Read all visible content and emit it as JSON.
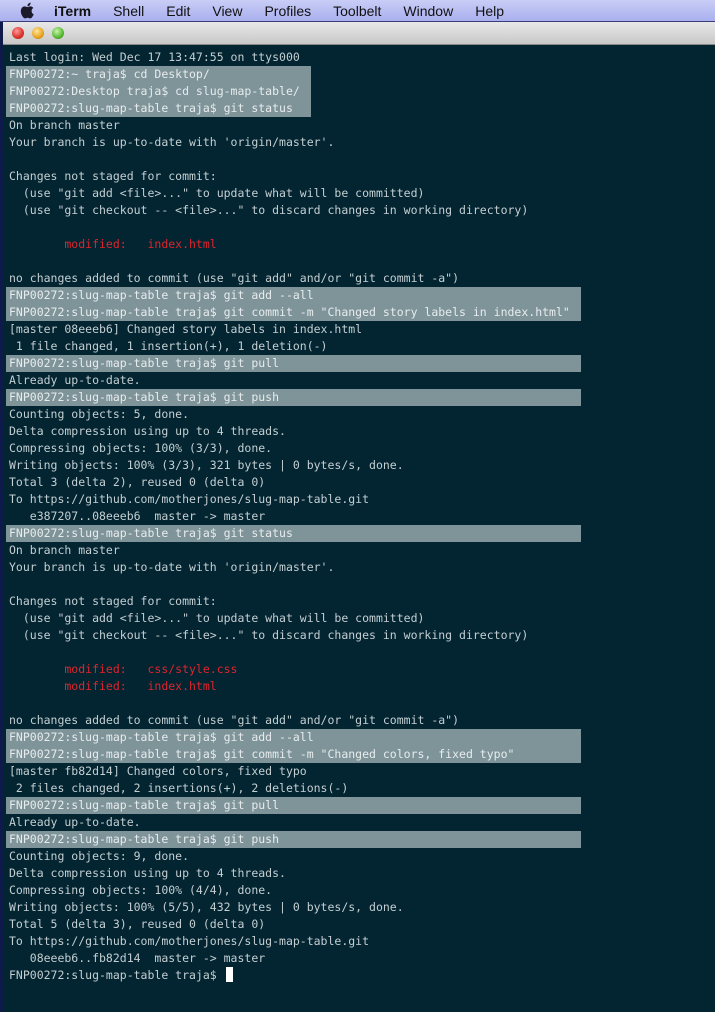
{
  "menubar": {
    "apple_icon": "apple-logo-icon",
    "items": [
      "iTerm",
      "Shell",
      "Edit",
      "View",
      "Profiles",
      "Toolbelt",
      "Window",
      "Help"
    ]
  },
  "window": {
    "traffic_lights": [
      "close",
      "minimize",
      "zoom"
    ],
    "colors": {
      "background": "#032431",
      "text": "#c4cfd2",
      "selection": "#7f9499",
      "modified": "#e0242c"
    }
  },
  "terminal": {
    "lines": [
      {
        "text": "Last login: Wed Dec 17 13:47:55 on ttys000",
        "sel": false
      },
      {
        "text": "FNP00272:~ traja$ cd Desktop/",
        "sel": true,
        "w": 1
      },
      {
        "text": "FNP00272:Desktop traja$ cd slug-map-table/",
        "sel": true,
        "w": 1
      },
      {
        "text": "FNP00272:slug-map-table traja$ git status",
        "sel": true,
        "w": 1
      },
      {
        "text": "On branch master",
        "sel": false
      },
      {
        "text": "Your branch is up-to-date with 'origin/master'.",
        "sel": false
      },
      {
        "text": "",
        "sel": false
      },
      {
        "text": "Changes not staged for commit:",
        "sel": false
      },
      {
        "text": "  (use \"git add <file>...\" to update what will be committed)",
        "sel": false
      },
      {
        "text": "  (use \"git checkout -- <file>...\" to discard changes in working directory)",
        "sel": false
      },
      {
        "text": "",
        "sel": false
      },
      {
        "text": "        modified:   index.html",
        "sel": false,
        "red": true
      },
      {
        "text": "",
        "sel": false
      },
      {
        "text": "no changes added to commit (use \"git add\" and/or \"git commit -a\")",
        "sel": false
      },
      {
        "text": "FNP00272:slug-map-table traja$ git add --all",
        "sel": true,
        "w": 2
      },
      {
        "text": "FNP00272:slug-map-table traja$ git commit -m \"Changed story labels in index.html\"",
        "sel": true,
        "w": 2
      },
      {
        "text": "[master 08eeeb6] Changed story labels in index.html",
        "sel": false
      },
      {
        "text": " 1 file changed, 1 insertion(+), 1 deletion(-)",
        "sel": false
      },
      {
        "text": "FNP00272:slug-map-table traja$ git pull",
        "sel": true,
        "w": 2
      },
      {
        "text": "Already up-to-date.",
        "sel": false
      },
      {
        "text": "FNP00272:slug-map-table traja$ git push",
        "sel": true,
        "w": 2
      },
      {
        "text": "Counting objects: 5, done.",
        "sel": false
      },
      {
        "text": "Delta compression using up to 4 threads.",
        "sel": false
      },
      {
        "text": "Compressing objects: 100% (3/3), done.",
        "sel": false
      },
      {
        "text": "Writing objects: 100% (3/3), 321 bytes | 0 bytes/s, done.",
        "sel": false
      },
      {
        "text": "Total 3 (delta 2), reused 0 (delta 0)",
        "sel": false
      },
      {
        "text": "To https://github.com/motherjones/slug-map-table.git",
        "sel": false
      },
      {
        "text": "   e387207..08eeeb6  master -> master",
        "sel": false
      },
      {
        "text": "FNP00272:slug-map-table traja$ git status",
        "sel": true,
        "w": 2
      },
      {
        "text": "On branch master",
        "sel": false
      },
      {
        "text": "Your branch is up-to-date with 'origin/master'.",
        "sel": false
      },
      {
        "text": "",
        "sel": false
      },
      {
        "text": "Changes not staged for commit:",
        "sel": false
      },
      {
        "text": "  (use \"git add <file>...\" to update what will be committed)",
        "sel": false
      },
      {
        "text": "  (use \"git checkout -- <file>...\" to discard changes in working directory)",
        "sel": false
      },
      {
        "text": "",
        "sel": false
      },
      {
        "text": "        modified:   css/style.css",
        "sel": false,
        "red": true
      },
      {
        "text": "        modified:   index.html",
        "sel": false,
        "red": true
      },
      {
        "text": "",
        "sel": false
      },
      {
        "text": "no changes added to commit (use \"git add\" and/or \"git commit -a\")",
        "sel": false
      },
      {
        "text": "FNP00272:slug-map-table traja$ git add --all",
        "sel": true,
        "w": 2
      },
      {
        "text": "FNP00272:slug-map-table traja$ git commit -m \"Changed colors, fixed typo\"",
        "sel": true,
        "w": 2
      },
      {
        "text": "[master fb82d14] Changed colors, fixed typo",
        "sel": false
      },
      {
        "text": " 2 files changed, 2 insertions(+), 2 deletions(-)",
        "sel": false
      },
      {
        "text": "FNP00272:slug-map-table traja$ git pull",
        "sel": true,
        "w": 2
      },
      {
        "text": "Already up-to-date.",
        "sel": false
      },
      {
        "text": "FNP00272:slug-map-table traja$ git push",
        "sel": true,
        "w": 2
      },
      {
        "text": "Counting objects: 9, done.",
        "sel": false
      },
      {
        "text": "Delta compression using up to 4 threads.",
        "sel": false
      },
      {
        "text": "Compressing objects: 100% (4/4), done.",
        "sel": false
      },
      {
        "text": "Writing objects: 100% (5/5), 432 bytes | 0 bytes/s, done.",
        "sel": false
      },
      {
        "text": "Total 5 (delta 3), reused 0 (delta 0)",
        "sel": false
      },
      {
        "text": "To https://github.com/motherjones/slug-map-table.git",
        "sel": false
      },
      {
        "text": "   08eeeb6..fb82d14  master -> master",
        "sel": false
      }
    ],
    "prompt": "FNP00272:slug-map-table traja$ "
  }
}
